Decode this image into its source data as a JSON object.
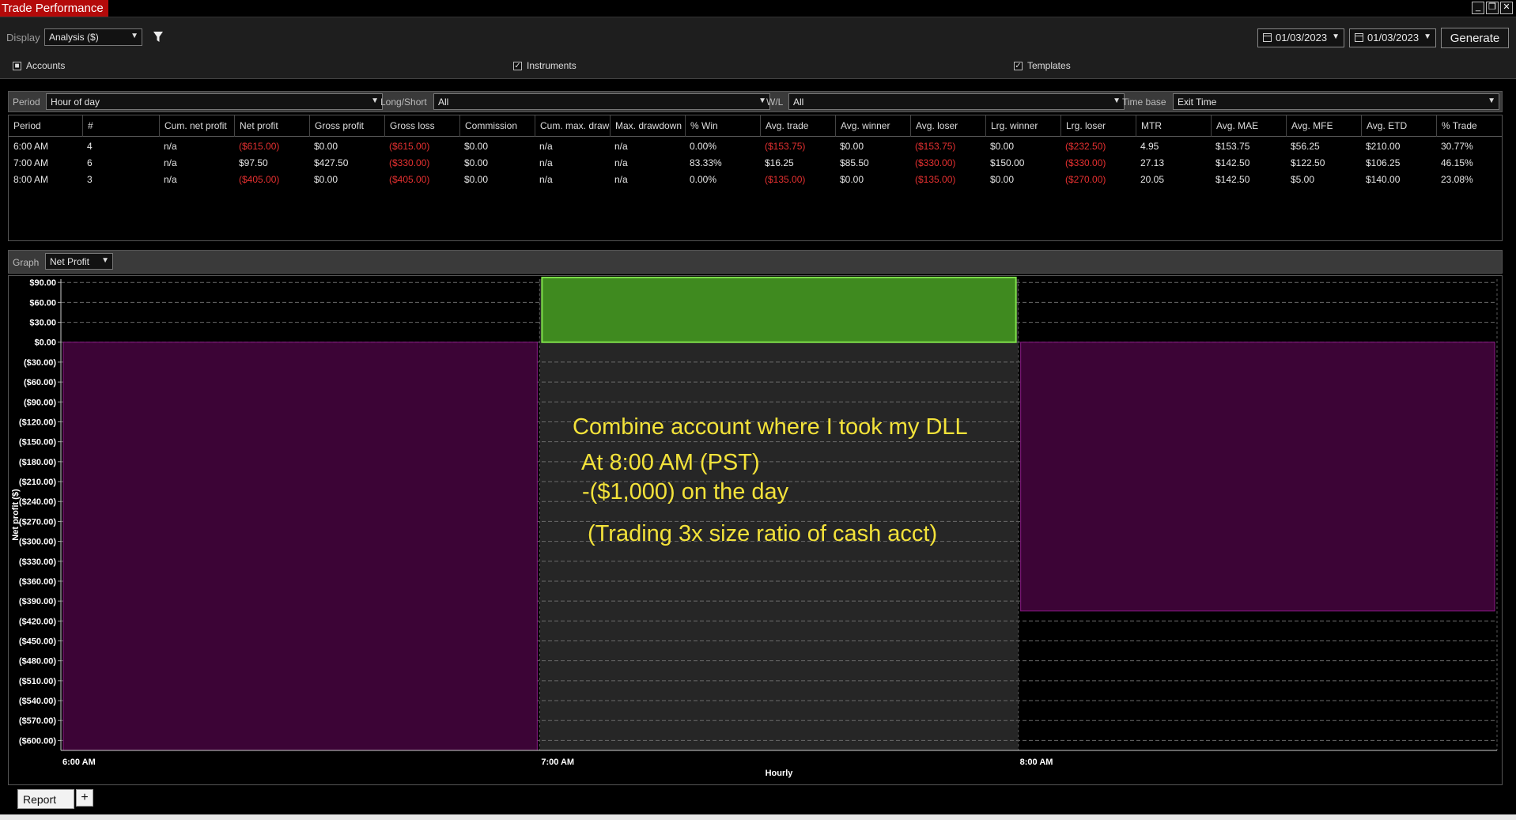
{
  "window": {
    "title": "Trade Performance",
    "buttons": [
      "_",
      "❐",
      "✕"
    ]
  },
  "toolbar": {
    "display_label": "Display",
    "display_value": "Analysis ($)",
    "date_from": "01/03/2023",
    "date_to": "01/03/2023",
    "generate_label": "Generate",
    "accounts_label": "Accounts",
    "instruments_label": "Instruments",
    "templates_label": "Templates"
  },
  "filters": {
    "period_label": "Period",
    "period_value": "Hour of day",
    "longshort_label": "Long/Short",
    "longshort_value": "All",
    "wl_label": "W/L",
    "wl_value": "All",
    "timebase_label": "Time base",
    "timebase_value": "Exit Time"
  },
  "table": {
    "columns": [
      "Period",
      "#",
      "Cum. net profit",
      "Net profit",
      "Gross profit",
      "Gross loss",
      "Commission",
      "Cum. max. drawdown",
      "Max. drawdown",
      "% Win",
      "Avg. trade",
      "Avg. winner",
      "Avg. loser",
      "Lrg. winner",
      "Lrg. loser",
      "MTR",
      "Avg. MAE",
      "Avg. MFE",
      "Avg. ETD",
      "% Trade"
    ],
    "rows": [
      [
        "6:00 AM",
        "4",
        "n/a",
        "($615.00)",
        "$0.00",
        "($615.00)",
        "$0.00",
        "n/a",
        "n/a",
        "0.00%",
        "($153.75)",
        "$0.00",
        "($153.75)",
        "$0.00",
        "($232.50)",
        "4.95",
        "$153.75",
        "$56.25",
        "$210.00",
        "30.77%"
      ],
      [
        "7:00 AM",
        "6",
        "n/a",
        "$97.50",
        "$427.50",
        "($330.00)",
        "$0.00",
        "n/a",
        "n/a",
        "83.33%",
        "$16.25",
        "$85.50",
        "($330.00)",
        "$150.00",
        "($330.00)",
        "27.13",
        "$142.50",
        "$122.50",
        "$106.25",
        "46.15%"
      ],
      [
        "8:00 AM",
        "3",
        "n/a",
        "($405.00)",
        "$0.00",
        "($405.00)",
        "$0.00",
        "n/a",
        "n/a",
        "0.00%",
        "($135.00)",
        "$0.00",
        "($135.00)",
        "$0.00",
        "($270.00)",
        "20.05",
        "$142.50",
        "$5.00",
        "$140.00",
        "23.08%"
      ]
    ]
  },
  "graph": {
    "label": "Graph",
    "value": "Net Profit"
  },
  "chart_data": {
    "type": "bar",
    "categories": [
      "6:00 AM",
      "7:00 AM",
      "8:00 AM"
    ],
    "values": [
      -615,
      97.5,
      -405
    ],
    "ylim": [
      -615,
      95
    ],
    "yticks": [
      90,
      60,
      30,
      0,
      -30,
      -60,
      -90,
      -120,
      -150,
      -180,
      -210,
      -240,
      -270,
      -300,
      -330,
      -360,
      -390,
      -420,
      -450,
      -480,
      -510,
      -540,
      -570,
      -600
    ],
    "ytick_labels": [
      "$90.00",
      "$60.00",
      "$30.00",
      "$0.00",
      "($30.00)",
      "($60.00)",
      "($90.00)",
      "($120.00)",
      "($150.00)",
      "($180.00)",
      "($210.00)",
      "($240.00)",
      "($270.00)",
      "($300.00)",
      "($330.00)",
      "($360.00)",
      "($390.00)",
      "($420.00)",
      "($450.00)",
      "($480.00)",
      "($510.00)",
      "($540.00)",
      "($570.00)",
      "($600.00)"
    ],
    "ylabel": "Net profit ($)",
    "xlabel": "Hourly",
    "grid": true,
    "colors": {
      "negative": "#3c0436",
      "negative_border": "#8b1a86",
      "positive": "#3f8a1f",
      "positive_border": "#7fe04a",
      "highlight_band": "#262626"
    },
    "annotations": [
      "Combine account where I took my DLL",
      "At 8:00  AM (PST)",
      "-($1,000) on the day",
      "(Trading 3x size ratio of cash acct)"
    ]
  },
  "tabs": {
    "report_label": "Report",
    "add_label": "+"
  }
}
